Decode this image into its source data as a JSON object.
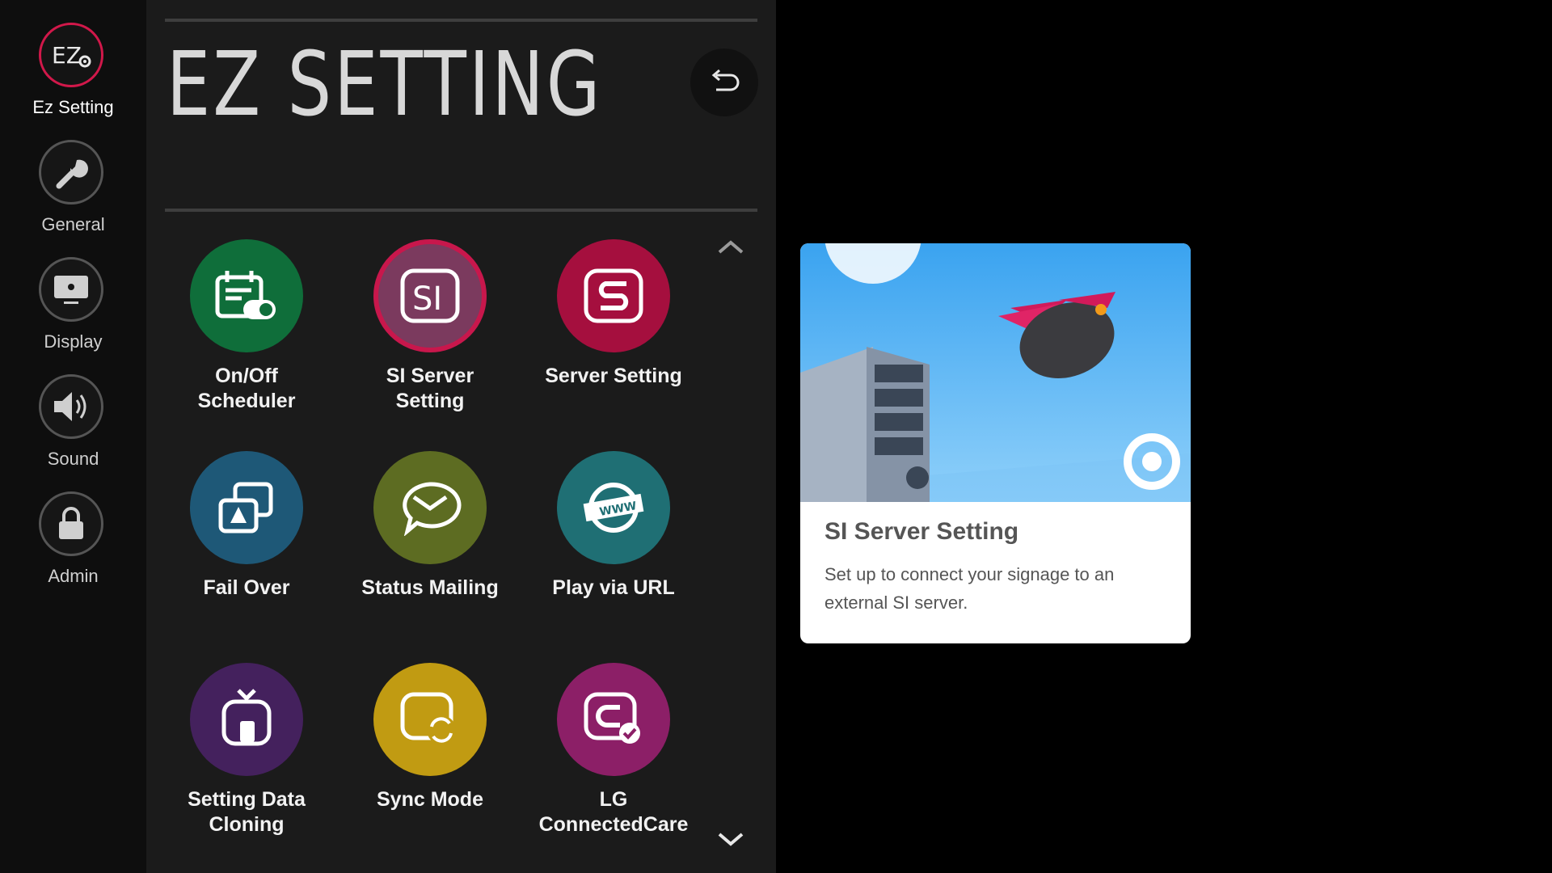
{
  "sidebar": {
    "items": [
      {
        "label": "Ez Setting",
        "icon": "ez-setting-icon",
        "active": true
      },
      {
        "label": "General",
        "icon": "wrench-icon"
      },
      {
        "label": "Display",
        "icon": "display-icon"
      },
      {
        "label": "Sound",
        "icon": "speaker-icon"
      },
      {
        "label": "Admin",
        "icon": "lock-icon"
      }
    ]
  },
  "header": {
    "title": "EZ SETTING",
    "back_icon": "back-arrow-icon"
  },
  "grid": {
    "tiles": [
      {
        "label": "On/Off\nScheduler",
        "icon": "scheduler-icon",
        "color": "#0f6e3a"
      },
      {
        "label": "SI Server\nSetting",
        "icon": "si-server-icon",
        "color": "#7b3a5e",
        "focused": true
      },
      {
        "label": "Server Setting",
        "icon": "server-setting-icon",
        "color": "#a50f3e"
      },
      {
        "label": "Fail Over",
        "icon": "fail-over-icon",
        "color": "#1e5877"
      },
      {
        "label": "Status Mailing",
        "icon": "mail-icon",
        "color": "#5d6c22"
      },
      {
        "label": "Play via URL",
        "icon": "www-icon",
        "color": "#1f6f74"
      },
      {
        "label": "Setting Data\nCloning",
        "icon": "cloning-icon",
        "color": "#44215d"
      },
      {
        "label": "Sync Mode",
        "icon": "sync-icon",
        "color": "#c19b12"
      },
      {
        "label": "LG\nConnectedCare",
        "icon": "connected-care-icon",
        "color": "#8c1f67"
      }
    ]
  },
  "info_card": {
    "title": "SI Server Setting",
    "description": "Set up to connect your signage to an external SI server."
  },
  "colors": {
    "accent": "#d1184a",
    "panel_bg": "#1b1b1b",
    "sidebar_bg": "#0e0e0e"
  }
}
